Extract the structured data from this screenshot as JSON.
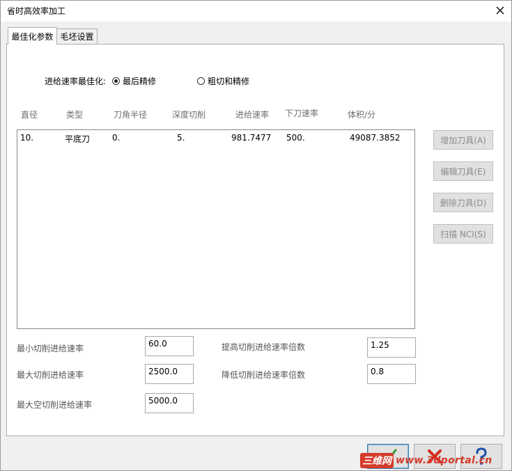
{
  "window": {
    "title": "省时高效率加工"
  },
  "tabs": [
    {
      "label": "最佳化参数",
      "active": true
    },
    {
      "label": "毛坯设置",
      "active": false
    }
  ],
  "optimize": {
    "label": "进给速率最佳化:",
    "options": [
      {
        "label": "最后精修",
        "selected": true
      },
      {
        "label": "粗切和精修",
        "selected": false
      }
    ]
  },
  "tool_table": {
    "columns": [
      "直径",
      "类型",
      "刀角半径",
      "深度切削",
      "进给速率",
      "下刀速率",
      "体积/分"
    ],
    "rows": [
      [
        "10.",
        "平底刀",
        "0.",
        "5.",
        "981.7477",
        "500.",
        "49087.3852"
      ]
    ]
  },
  "side_buttons": [
    "增加刀具(A)",
    "编辑刀具(E)",
    "删除刀具(D)",
    "扫描 NCI(S)"
  ],
  "fields": {
    "min_feed": {
      "label": "最小切削进给速率",
      "value": "60.0"
    },
    "max_feed": {
      "label": "最大切削进给速率",
      "value": "2500.0"
    },
    "max_air_feed": {
      "label": "最大空切削进给速率",
      "value": "5000.0"
    },
    "increase_factor": {
      "label": "提高切削进给速率倍数",
      "value": "1.25"
    },
    "decrease_factor": {
      "label": "降低切削进给速率倍数",
      "value": "0.8"
    }
  },
  "watermark": {
    "cn": "三维网",
    "url": "www.3dportal.cn"
  },
  "colors": {
    "ok_check": "#2e9a2e",
    "cancel_x": "#d42a1e",
    "help_q": "#1f4fa8"
  }
}
